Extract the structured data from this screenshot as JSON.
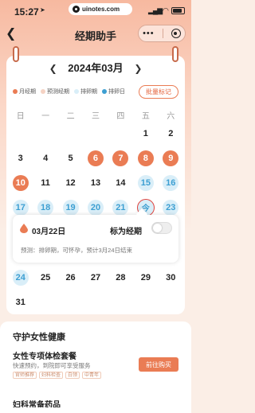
{
  "status_bar": {
    "time": "15:27",
    "url": "uinotes.com"
  },
  "nav": {
    "back_icon": "back-chevron-icon",
    "title": "经期助手"
  },
  "calendar": {
    "month_title": "2024年03月",
    "prev_arrow": "❮",
    "next_arrow": "❯",
    "legend": [
      {
        "label": "月经期",
        "color": "#ea7c54"
      },
      {
        "label": "预测经期",
        "color": "#f5d3c4"
      },
      {
        "label": "排卵期",
        "color": "#d9eef8"
      },
      {
        "label": "排卵日",
        "color": "#3d9fd2"
      }
    ],
    "batch_button": "批量标记",
    "weekdays": [
      "日",
      "一",
      "二",
      "三",
      "四",
      "五",
      "六"
    ],
    "rows": [
      [
        {
          "d": "",
          "s": ""
        },
        {
          "d": "",
          "s": ""
        },
        {
          "d": "",
          "s": ""
        },
        {
          "d": "",
          "s": ""
        },
        {
          "d": "",
          "s": ""
        },
        {
          "d": "1",
          "s": ""
        },
        {
          "d": "2",
          "s": ""
        }
      ],
      [
        {
          "d": "3",
          "s": ""
        },
        {
          "d": "4",
          "s": ""
        },
        {
          "d": "5",
          "s": ""
        },
        {
          "d": "6",
          "s": "period"
        },
        {
          "d": "7",
          "s": "period"
        },
        {
          "d": "8",
          "s": "period"
        },
        {
          "d": "9",
          "s": "period"
        }
      ],
      [
        {
          "d": "10",
          "s": "period"
        },
        {
          "d": "11",
          "s": ""
        },
        {
          "d": "12",
          "s": ""
        },
        {
          "d": "13",
          "s": ""
        },
        {
          "d": "14",
          "s": ""
        },
        {
          "d": "15",
          "s": "ovu"
        },
        {
          "d": "16",
          "s": "ovu"
        }
      ],
      [
        {
          "d": "17",
          "s": "ovu"
        },
        {
          "d": "18",
          "s": "ovu"
        },
        {
          "d": "19",
          "s": "ovu"
        },
        {
          "d": "20",
          "s": "ovu",
          "dot": true
        },
        {
          "d": "21",
          "s": "ovu"
        },
        {
          "d": "今",
          "s": "today"
        },
        {
          "d": "23",
          "s": "ovu"
        }
      ],
      [
        {
          "d": "24",
          "s": "ovu"
        },
        {
          "d": "25",
          "s": ""
        },
        {
          "d": "26",
          "s": ""
        },
        {
          "d": "27",
          "s": ""
        },
        {
          "d": "28",
          "s": ""
        },
        {
          "d": "29",
          "s": ""
        },
        {
          "d": "30",
          "s": ""
        }
      ],
      [
        {
          "d": "31",
          "s": ""
        },
        {
          "d": "",
          "s": ""
        },
        {
          "d": "",
          "s": ""
        },
        {
          "d": "",
          "s": ""
        },
        {
          "d": "",
          "s": ""
        },
        {
          "d": "",
          "s": ""
        },
        {
          "d": "",
          "s": ""
        }
      ]
    ]
  },
  "popup": {
    "date": "03月22日",
    "mark_label": "标为经期",
    "toggle_on": false,
    "prediction": "预测：排卵期，可怀孕，预计3月24日结束"
  },
  "section": {
    "title": "守护女性健康",
    "product_title": "女性专项体检套餐",
    "product_sub": "快速预约，到院即可享受服务",
    "tags": [
      "官师推荐",
      "妇科检查",
      "白领",
      "中青年"
    ],
    "buy_button": "前往购买",
    "product2_title": "妇科常备药品"
  }
}
